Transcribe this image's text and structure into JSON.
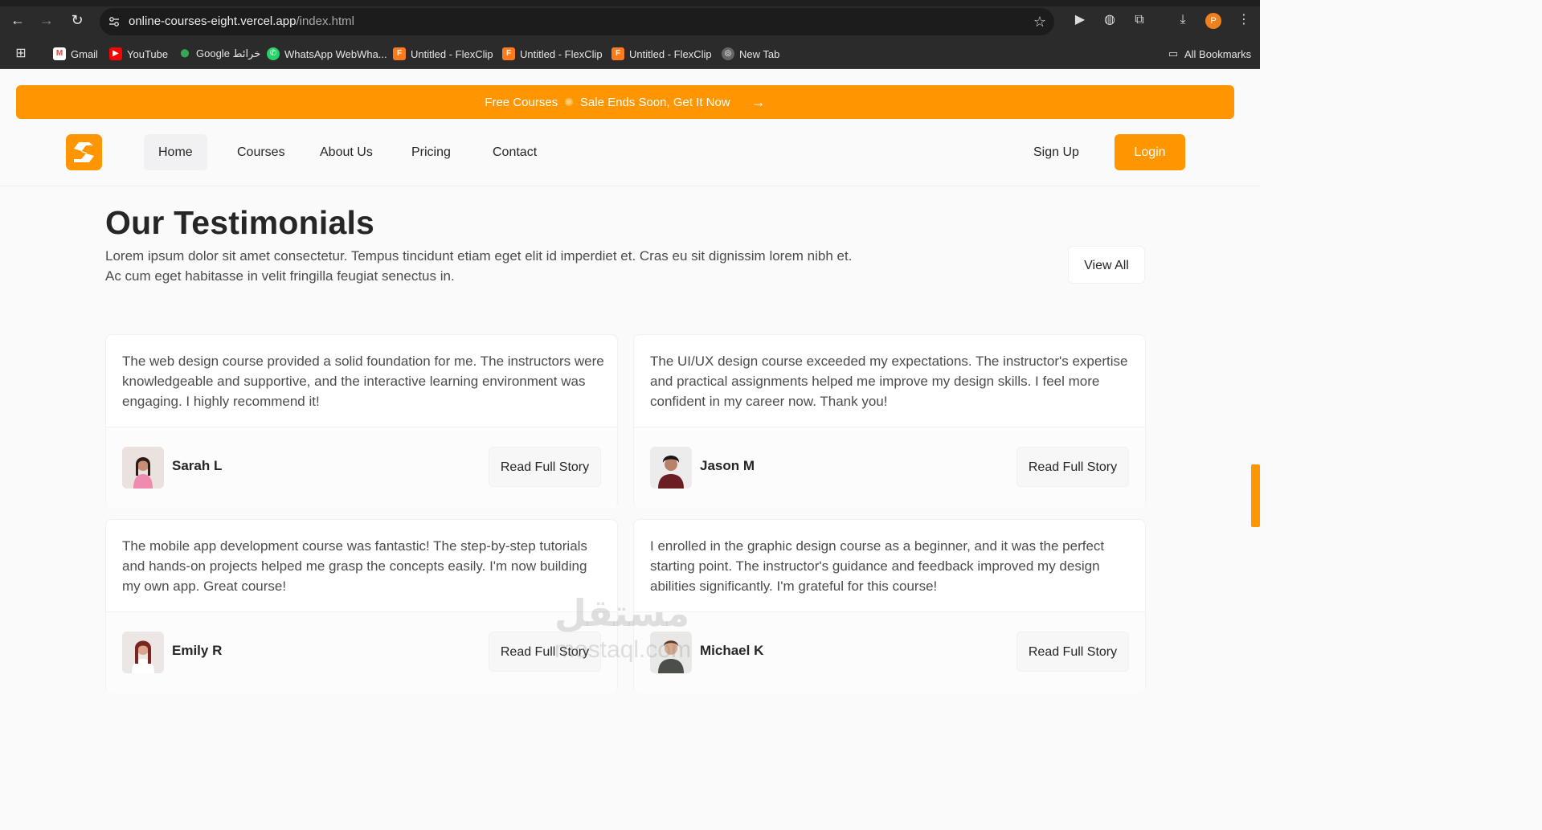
{
  "browser": {
    "url_host": "online-courses-eight.vercel.app",
    "url_path": "/index.html",
    "profile_initial": "P",
    "bookmarks": [
      {
        "label": "Gmail",
        "icon": "gmail-icon"
      },
      {
        "label": "YouTube",
        "icon": "youtube-icon"
      },
      {
        "label": "Google خرائط",
        "icon": "maps-icon"
      },
      {
        "label": "WhatsApp WebWha...",
        "icon": "whatsapp-icon"
      },
      {
        "label": "Untitled - FlexClip",
        "icon": "flexclip-icon"
      },
      {
        "label": "Untitled - FlexClip",
        "icon": "flexclip-icon"
      },
      {
        "label": "Untitled - FlexClip",
        "icon": "flexclip-icon"
      },
      {
        "label": "New Tab",
        "icon": "globe-icon"
      }
    ],
    "all_bookmarks": "All Bookmarks"
  },
  "banner": {
    "left": "Free Courses",
    "right": "Sale Ends Soon, Get It Now"
  },
  "nav": {
    "links": [
      "Home",
      "Courses",
      "About Us",
      "Pricing",
      "Contact"
    ],
    "signup": "Sign Up",
    "login": "Login"
  },
  "section": {
    "title": "Our Testimonials",
    "intro": "Lorem ipsum dolor sit amet consectetur. Tempus tincidunt etiam eget elit id imperdiet et. Cras eu sit dignissim lorem nibh et. Ac cum eget habitasse in velit fringilla feugiat senectus in.",
    "view_all": "View All"
  },
  "testimonials": [
    {
      "quote": "The web design course provided a solid foundation for me. The instructors were knowledgeable and supportive, and the interactive learning environment was engaging. I highly recommend it!",
      "name": "Sarah L",
      "button": "Read Full Story"
    },
    {
      "quote": "The UI/UX design course exceeded my expectations. The instructor's expertise and practical assignments helped me improve my design skills. I feel more confident in my career now. Thank you!",
      "name": "Jason M",
      "button": "Read Full Story"
    },
    {
      "quote": "The mobile app development course was fantastic! The step-by-step tutorials and hands-on projects helped me grasp the concepts easily. I'm now building my own app. Great course!",
      "name": "Emily R",
      "button": "Read Full Story"
    },
    {
      "quote": "I enrolled in the graphic design course as a beginner, and it was the perfect starting point. The instructor's guidance and feedback improved my design abilities significantly. I'm grateful for this course!",
      "name": "Michael K",
      "button": "Read Full Story"
    }
  ],
  "watermark": {
    "line1": "مستقل",
    "line2": "mostaql.com"
  },
  "colors": {
    "accent": "#ff9500",
    "text": "#262626",
    "muted": "#4c4c4d"
  }
}
